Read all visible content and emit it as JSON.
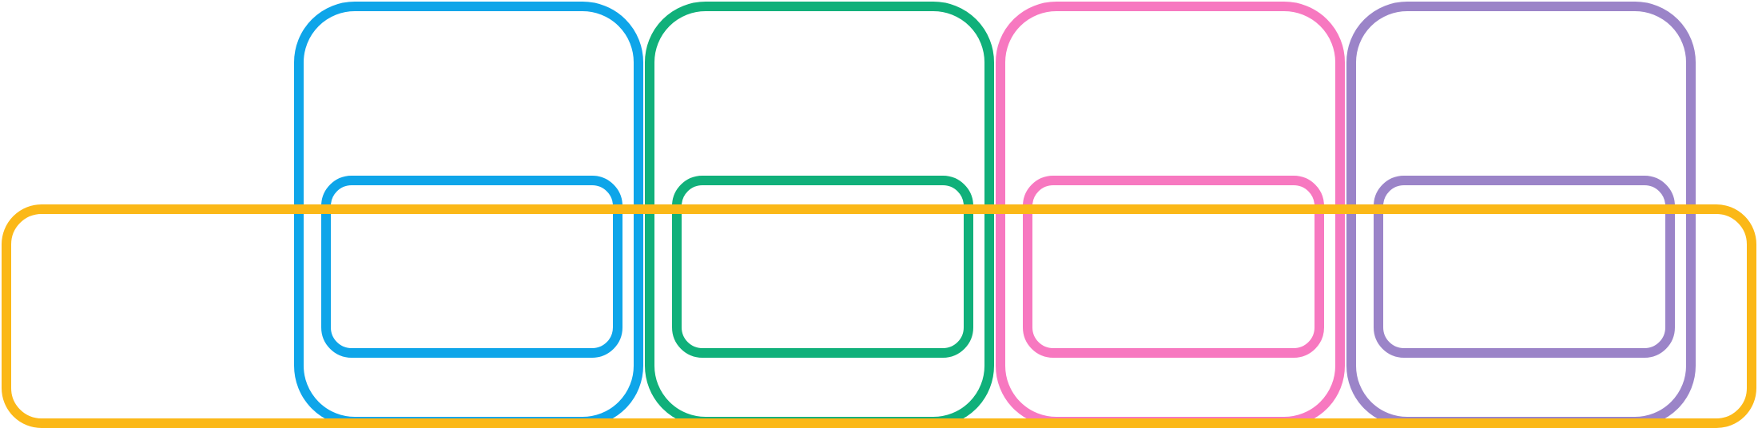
{
  "diagram": {
    "columns": [
      {
        "key": "column-1",
        "color": "#0ea5e9"
      },
      {
        "key": "column-2",
        "color": "#10b07a"
      },
      {
        "key": "column-3",
        "color": "#f778c0"
      },
      {
        "key": "column-4",
        "color": "#9b84c8"
      }
    ],
    "band": {
      "key": "row-band",
      "color": "#fbb817"
    },
    "background": "#ffffff"
  }
}
